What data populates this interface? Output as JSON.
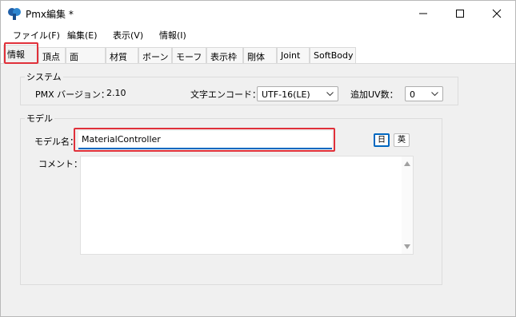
{
  "window": {
    "title": "Pmx編集 *"
  },
  "menu": [
    "ファイル(F)",
    "編集(E)",
    "表示(V)",
    "情報(I)"
  ],
  "tabs": [
    "情報",
    "頂点",
    "面",
    "材質",
    "ボーン",
    "モーフ",
    "表示枠",
    "剛体",
    "Joint",
    "SoftBody"
  ],
  "system": {
    "title": "システム",
    "version_label": "PMX バージョン：",
    "version_value": "2.10",
    "encode_label": "文字エンコード：",
    "encode_value": "UTF-16(LE)",
    "uv_label": "追加UV数：",
    "uv_value": "0"
  },
  "model": {
    "title": "モデル",
    "name_label": "モデル名：",
    "name_value": "MaterialController",
    "comment_label": "コメント：",
    "lang_jp": "日",
    "lang_en": "英"
  },
  "colors": {
    "highlight": "#e0303a",
    "focus": "#0067c0"
  },
  "icons": [
    "app-icon",
    "minimize-icon",
    "maximize-icon",
    "close-icon",
    "chevron-down-icon",
    "scroll-up-icon",
    "scroll-down-icon"
  ]
}
